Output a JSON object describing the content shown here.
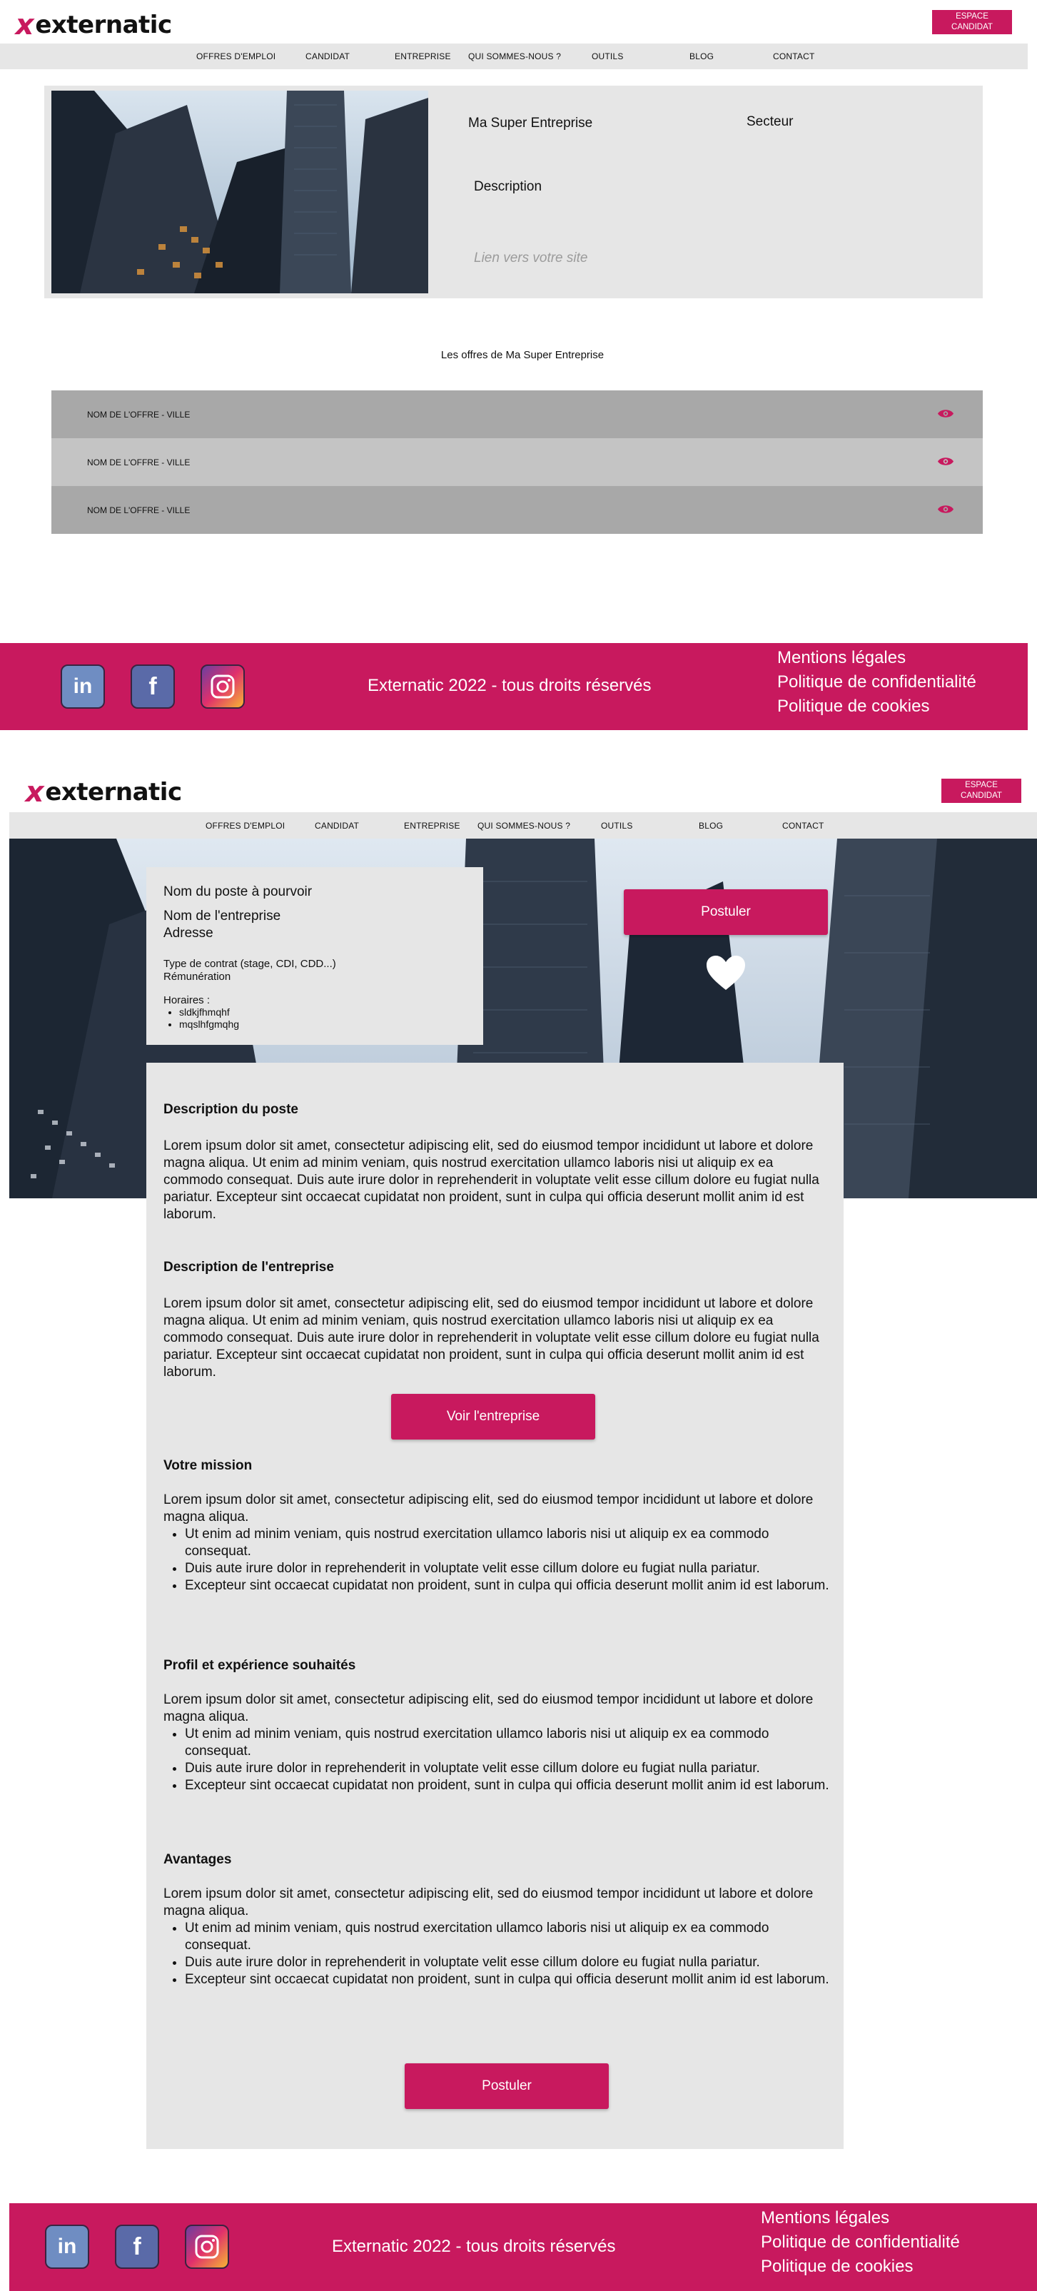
{
  "brand": {
    "logo_mark": "x",
    "logo_text": "externatic",
    "accent_color": "#c8195e"
  },
  "header": {
    "espace_line1": "ESPACE",
    "espace_line2": "CANDIDAT",
    "nav": [
      "OFFRES D'EMPLOI",
      "CANDIDAT",
      "ENTREPRISE",
      "QUI SOMMES-NOUS ?",
      "OUTILS",
      "BLOG",
      "CONTACT"
    ]
  },
  "company_page": {
    "company_name": "Ma Super Entreprise",
    "sector": "Secteur",
    "description": "Description",
    "website_placeholder": "Lien vers votre site",
    "offers_title": "Les offres de Ma Super Entreprise",
    "offers": [
      {
        "label": "NOM DE L'OFFRE - VILLE",
        "icon": "eye-icon"
      },
      {
        "label": "NOM DE L'OFFRE - VILLE",
        "icon": "eye-icon"
      },
      {
        "label": "NOM DE L'OFFRE - VILLE",
        "icon": "eye-icon"
      }
    ]
  },
  "footer": {
    "social": [
      "linkedin-icon",
      "facebook-icon",
      "instagram-icon"
    ],
    "linkedin_label": "in",
    "facebook_label": "f",
    "copyright": "Externatic 2022 - tous droits réservés",
    "links": [
      "Mentions légales",
      "Politique de confidentialité",
      "Politique de cookies"
    ]
  },
  "job_page": {
    "job_title": "Nom du poste à pourvoir",
    "company": "Nom de l'entreprise",
    "address": "Adresse",
    "contract": "Type de contrat (stage, CDI, CDD...)",
    "salary": "Rémunération",
    "hours_label": "Horaires :",
    "hours": [
      "sldkjfhmqhf",
      "mqslhfgmqhg"
    ],
    "apply_label": "Postuler",
    "favorite_icon": "heart-icon",
    "sections": {
      "poste_title": "Description du poste",
      "poste_text": "Lorem ipsum dolor sit amet, consectetur adipiscing elit, sed do eiusmod tempor incididunt ut labore et dolore magna aliqua. Ut enim ad minim veniam, quis nostrud exercitation ullamco laboris nisi ut aliquip ex ea commodo consequat. Duis aute irure dolor in reprehenderit in voluptate velit esse cillum dolore eu fugiat nulla pariatur. Excepteur sint occaecat cupidatat non proident, sunt in culpa qui officia deserunt mollit anim id est laborum.",
      "entreprise_title": "Description de l'entreprise",
      "entreprise_text": "Lorem ipsum dolor sit amet, consectetur adipiscing elit, sed do eiusmod tempor incididunt ut labore et dolore magna aliqua. Ut enim ad minim veniam, quis nostrud exercitation ullamco laboris nisi ut aliquip ex ea commodo consequat. Duis aute irure dolor in reprehenderit in voluptate velit esse cillum dolore eu fugiat nulla pariatur. Excepteur sint occaecat cupidatat non proident, sunt in culpa qui officia deserunt mollit anim id est laborum.",
      "voir_entreprise_label": "Voir l'entreprise",
      "mission_title": "Votre mission",
      "profil_title": "Profil et expérience souhaités",
      "avantages_title": "Avantages",
      "list_intro": "Lorem ipsum dolor sit amet, consectetur adipiscing elit, sed do eiusmod tempor incididunt ut labore et dolore magna aliqua.",
      "list_items": [
        "Ut enim ad minim veniam, quis nostrud exercitation ullamco laboris nisi ut aliquip ex ea commodo consequat.",
        "Duis aute irure dolor in reprehenderit in voluptate velit esse cillum dolore eu fugiat nulla pariatur.",
        "Excepteur sint occaecat cupidatat non proident, sunt in culpa qui officia deserunt mollit anim id est laborum."
      ]
    }
  }
}
